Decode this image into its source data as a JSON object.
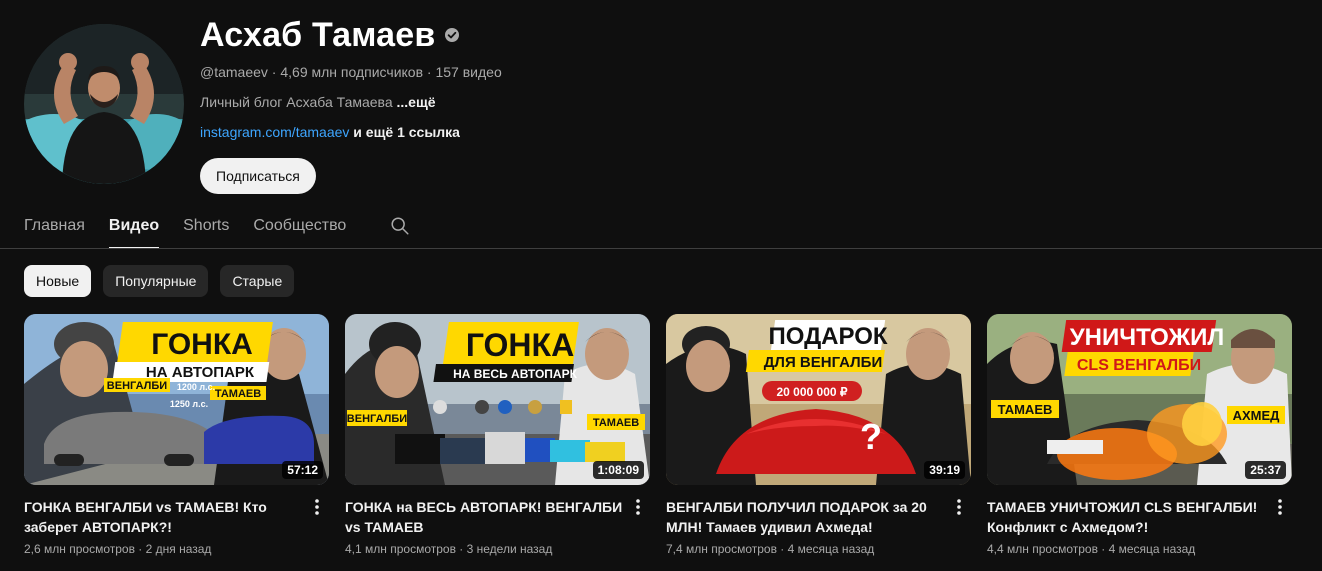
{
  "channel": {
    "name": "Асхаб Тамаев",
    "handle": "@tamaeev",
    "subscribers": "4,69 млн подписчиков",
    "video_count": "157 видео",
    "separator": " · ",
    "description": "Личный блог Асхаба Тамаева ",
    "description_more": "...ещё",
    "link": "instagram.com/tamaaev",
    "link_extra": " и ещё 1 ссылка",
    "subscribe_label": "Подписаться"
  },
  "tabs": [
    {
      "label": "Главная",
      "active": false
    },
    {
      "label": "Видео",
      "active": true
    },
    {
      "label": "Shorts",
      "active": false
    },
    {
      "label": "Сообщество",
      "active": false
    }
  ],
  "chips": [
    {
      "label": "Новые",
      "selected": true
    },
    {
      "label": "Популярные",
      "selected": false
    },
    {
      "label": "Старые",
      "selected": false
    }
  ],
  "videos": [
    {
      "title": "ГОНКА ВЕНГАЛБИ vs ТАМАЕВ! Кто заберет АВТОПАРК?!",
      "views": "2,6 млн просмотров",
      "age": "2 дня назад",
      "duration": "57:12",
      "thumb_text_1": "ГОНКА",
      "thumb_text_2": "НА АВТОПАРК",
      "thumb_label_left": "ВЕНГАЛБИ",
      "thumb_label_right": "ТАМАЕВ",
      "thumb_hp_1": "1200 л.с.",
      "thumb_hp_2": "1250 л.с."
    },
    {
      "title": "ГОНКА на ВЕСЬ АВТОПАРК! ВЕНГАЛБИ vs ТАМАЕВ",
      "views": "4,1 млн просмотров",
      "age": "3 недели назад",
      "duration": "1:08:09",
      "thumb_text_1": "ГОНКА",
      "thumb_text_2": "НА ВЕСЬ АВТОПАРК",
      "thumb_label_left": "ВЕНГАЛБИ",
      "thumb_label_right": "ТАМАЕВ"
    },
    {
      "title": "ВЕНГАЛБИ ПОЛУЧИЛ ПОДАРОК за 20 МЛН! Тамаев удивил Ахмеда!",
      "views": "7,4 млн просмотров",
      "age": "4 месяца назад",
      "duration": "39:19",
      "thumb_text_1": "ПОДАРОК",
      "thumb_text_2": "ДЛЯ ВЕНГАЛБИ",
      "thumb_price": "20 000 000 ₽"
    },
    {
      "title": "ТАМАЕВ УНИЧТОЖИЛ CLS ВЕНГАЛБИ! Конфликт с Ахмедом?!",
      "views": "4,4 млн просмотров",
      "age": "4 месяца назад",
      "duration": "25:37",
      "thumb_text_1": "УНИЧТОЖИЛ",
      "thumb_text_2": "CLS ВЕНГАЛБИ",
      "thumb_label_left": "ТАМАЕВ",
      "thumb_label_right": "АХМЕД"
    }
  ],
  "colors": {
    "background": "#0f0f0f",
    "link": "#3ea6ff",
    "chip": "#272727",
    "chip_selected": "#f1f1f1",
    "thumb_yellow": "#ffd800"
  },
  "icons": {
    "verified": "verified-check-icon",
    "search": "search-icon",
    "more": "more-vert-icon"
  }
}
